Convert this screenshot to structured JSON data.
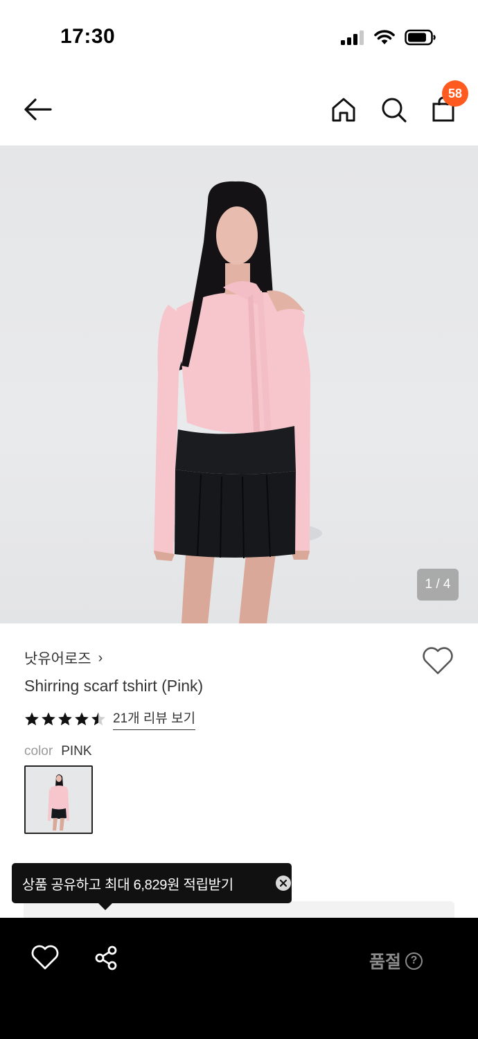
{
  "status_bar": {
    "time": "17:30"
  },
  "nav": {
    "cart_count": "58"
  },
  "gallery": {
    "counter": "1 / 4",
    "current": 1,
    "total": 4
  },
  "product": {
    "brand": "낫유어로즈",
    "brand_chevron": "›",
    "title": "Shirring scarf tshirt (Pink)",
    "rating": 4.5,
    "review_link": "21개 리뷰 보기",
    "color_label": "color",
    "color_value": "PINK"
  },
  "tooltip": {
    "text": "상품 공유하고 최대 6,829원 적립받기"
  },
  "bottom_bar": {
    "soldout_label": "품절",
    "help": "?"
  },
  "colors": {
    "badge": "#ff5a1f",
    "top": "#f6c6cc",
    "skirt": "#17181b",
    "hair": "#141214"
  }
}
